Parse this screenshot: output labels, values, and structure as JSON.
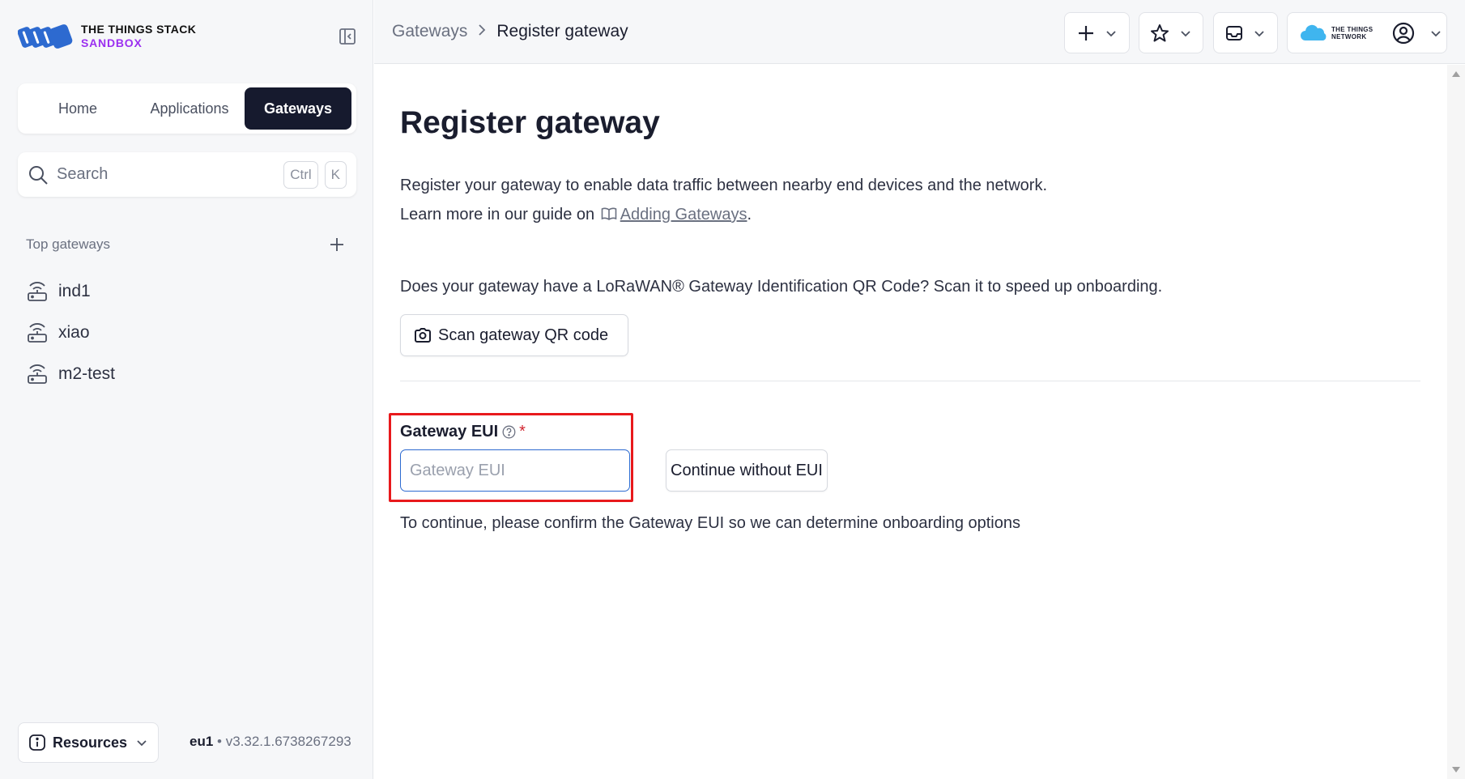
{
  "brand": {
    "line1": "THE THINGS STACK",
    "line2": "SANDBOX",
    "accent_color": "#9b2ff0",
    "logo_color": "#2d6ad0"
  },
  "sidebar": {
    "collapse_icon": "sidebar-collapse-icon",
    "nav_tabs": [
      {
        "label": "Home",
        "active": false
      },
      {
        "label": "Applications",
        "active": false
      },
      {
        "label": "Gateways",
        "active": true
      }
    ],
    "search": {
      "placeholder": "Search",
      "shortcut_keys": [
        "Ctrl",
        "K"
      ]
    },
    "top_gateways": {
      "title": "Top gateways",
      "items": [
        {
          "label": "ind1",
          "icon": "gateway-router-icon"
        },
        {
          "label": "xiao",
          "icon": "gateway-router-icon"
        },
        {
          "label": "m2-test",
          "icon": "gateway-router-icon"
        }
      ]
    },
    "resources_label": "Resources",
    "cluster": "eu1",
    "version_sep": "•",
    "version": "v3.32.1.6738267293"
  },
  "header": {
    "breadcrumb": [
      "Gateways",
      "Register gateway"
    ],
    "ttn_logo_text": [
      "THE THINGS",
      "NETWORK"
    ],
    "ttn_cloud_color": "#3fb5ef"
  },
  "main": {
    "title": "Register gateway",
    "intro_line1": "Register your gateway to enable data traffic between nearby end devices and the network.",
    "intro_line2_prefix": "Learn more in our guide on",
    "intro_link": "Adding Gateways",
    "intro_line2_suffix": ".",
    "qr_question": "Does your gateway have a LoRaWAN® Gateway Identification QR Code? Scan it to speed up onboarding.",
    "scan_button": "Scan gateway QR code",
    "eui_label": "Gateway EUI",
    "eui_required_mark": "*",
    "eui_placeholder": "Gateway EUI",
    "eui_value": "",
    "continue_button": "Continue without EUI",
    "hint": "To continue, please confirm the Gateway EUI so we can determine onboarding options",
    "highlight_color": "#e8191c"
  }
}
